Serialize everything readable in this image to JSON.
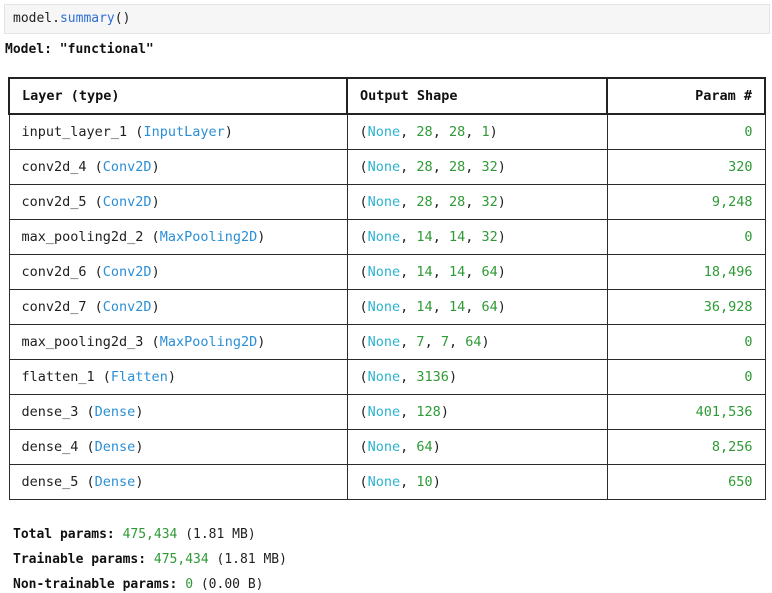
{
  "code_cell": {
    "object": "model",
    "dot": ".",
    "method": "summary",
    "parens": "()"
  },
  "model_line": {
    "prefix": "Model: ",
    "name": "\"functional\""
  },
  "table": {
    "headers": [
      "Layer (type)",
      "Output Shape",
      "Param #"
    ],
    "rows": [
      {
        "name": "input_layer_1",
        "type": "InputLayer",
        "shape": [
          "None",
          "28",
          "28",
          "1"
        ],
        "params": "0"
      },
      {
        "name": "conv2d_4",
        "type": "Conv2D",
        "shape": [
          "None",
          "28",
          "28",
          "32"
        ],
        "params": "320"
      },
      {
        "name": "conv2d_5",
        "type": "Conv2D",
        "shape": [
          "None",
          "28",
          "28",
          "32"
        ],
        "params": "9,248"
      },
      {
        "name": "max_pooling2d_2",
        "type": "MaxPooling2D",
        "shape": [
          "None",
          "14",
          "14",
          "32"
        ],
        "params": "0"
      },
      {
        "name": "conv2d_6",
        "type": "Conv2D",
        "shape": [
          "None",
          "14",
          "14",
          "64"
        ],
        "params": "18,496"
      },
      {
        "name": "conv2d_7",
        "type": "Conv2D",
        "shape": [
          "None",
          "14",
          "14",
          "64"
        ],
        "params": "36,928"
      },
      {
        "name": "max_pooling2d_3",
        "type": "MaxPooling2D",
        "shape": [
          "None",
          "7",
          "7",
          "64"
        ],
        "params": "0"
      },
      {
        "name": "flatten_1",
        "type": "Flatten",
        "shape": [
          "None",
          "3136"
        ],
        "params": "0"
      },
      {
        "name": "dense_3",
        "type": "Dense",
        "shape": [
          "None",
          "128"
        ],
        "params": "401,536"
      },
      {
        "name": "dense_4",
        "type": "Dense",
        "shape": [
          "None",
          "64"
        ],
        "params": "8,256"
      },
      {
        "name": "dense_5",
        "type": "Dense",
        "shape": [
          "None",
          "10"
        ],
        "params": "650"
      }
    ]
  },
  "totals": [
    {
      "label": "Total params:",
      "value": "475,434",
      "size": "(1.81 MB)"
    },
    {
      "label": "Trainable params:",
      "value": "475,434",
      "size": "(1.81 MB)"
    },
    {
      "label": "Non-trainable params:",
      "value": "0",
      "size": "(0.00 B)"
    }
  ],
  "colors": {
    "type": "#2b8fd6",
    "none": "#2bb3cf",
    "number": "#2e9a35",
    "method": "#2f6fd6"
  }
}
